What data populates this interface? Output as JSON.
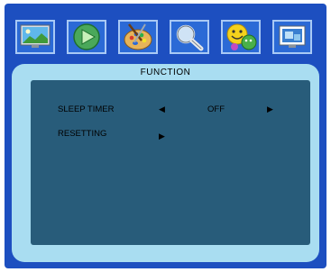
{
  "icons": [
    {
      "name": "picture-icon"
    },
    {
      "name": "audio-icon"
    },
    {
      "name": "palette-icon"
    },
    {
      "name": "search-icon"
    },
    {
      "name": "smiley-icon"
    },
    {
      "name": "window-icon"
    }
  ],
  "panel": {
    "title": "FUNCTION",
    "items": [
      {
        "label": "SLEEP TIMER",
        "left_arrow": "◀",
        "value": "OFF",
        "right_arrow": "▶"
      },
      {
        "label": "RESETTING",
        "right_arrow": "▶"
      }
    ]
  }
}
